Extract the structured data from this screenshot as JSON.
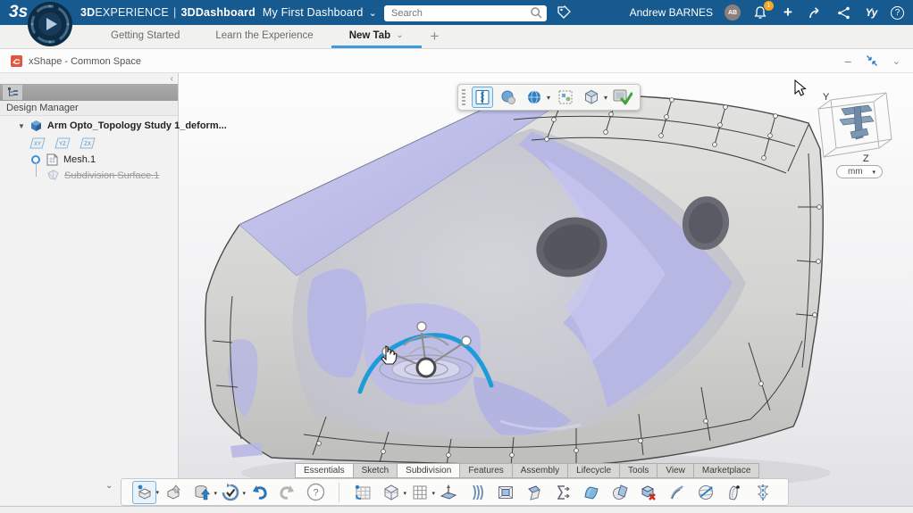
{
  "topbar": {
    "logo_text": "3s",
    "brand_bold": "3D",
    "brand_light": "EXPERIENCE",
    "separator": "|",
    "app_name": "3DDashboard",
    "dashboard_name": "My First Dashboard",
    "search_placeholder": "Search",
    "user_name": "Andrew BARNES",
    "user_initials": "AB",
    "notification_count": "1"
  },
  "glyphs": {
    "chevron_down": "⌄",
    "chevron_left": "‹",
    "minimize": "–",
    "plus": "+",
    "question": "?",
    "swym": "Yy",
    "caret": "▾",
    "tree_expand": "▼",
    "bar_chevron": "⌄"
  },
  "dashboard_tabs": {
    "items": [
      {
        "label": "Getting Started",
        "state": "default"
      },
      {
        "label": "Learn the Experience",
        "state": "default"
      },
      {
        "label": "New Tab",
        "state": "active"
      }
    ],
    "add_label": "+"
  },
  "app_header": {
    "title": "xShape - Common Space"
  },
  "left_panel": {
    "title": "Design Manager",
    "tree": {
      "root_label": "Arm Opto_Topology Study 1_deform...",
      "plane_icons": [
        "XY",
        "YZ",
        "ZX"
      ],
      "children": [
        {
          "label": "Mesh.1",
          "struck": false
        },
        {
          "label": "Subdivision Surface.1",
          "struck": true
        }
      ]
    }
  },
  "viewport": {
    "units_value": "mm",
    "axis_y": "Y",
    "axis_z": "Z",
    "view_toolbar_icons": [
      "section-zipper-tool",
      "shaded-sphere-style",
      "globe-render-mode",
      "custom-render-style",
      "cube-view-mode",
      "validate-ok"
    ]
  },
  "ribbon": {
    "active_tab": "Subdivision",
    "tabs": [
      {
        "label": "Essentials",
        "state": "light"
      },
      {
        "label": "Sketch",
        "state": "default"
      },
      {
        "label": "Subdivision",
        "state": "active"
      },
      {
        "label": "Features",
        "state": "default"
      },
      {
        "label": "Assembly",
        "state": "default"
      },
      {
        "label": "Lifecycle",
        "state": "default"
      },
      {
        "label": "Tools",
        "state": "default"
      },
      {
        "label": "View",
        "state": "default"
      },
      {
        "label": "Marketplace",
        "state": "default"
      }
    ]
  },
  "action_bar": {
    "standard_icons": [
      "new-content",
      "import-content",
      "save-data",
      "update",
      "undo",
      "redo",
      "help"
    ],
    "subdivision_icons": [
      "subdivision-surface",
      "primitive-shape",
      "mesh-grid",
      "extrude-face",
      "multi-section-surface",
      "frame-inset",
      "bevel-face",
      "align-edges",
      "fill-surface",
      "trim-by-plane",
      "delete-face",
      "styling-curve",
      "project-on-sphere",
      "offset-surface",
      "symmetry"
    ]
  },
  "colors": {
    "topbar_blue": "#175A8F",
    "accent_blue": "#2D9BD8",
    "badge_orange": "#F5A623",
    "lavender": "#BCBCE8",
    "model_gray": "#D6D6D4",
    "curve_blue": "#1E9CD7",
    "xshape_red": "#E2553F",
    "check_green": "#3FA535"
  }
}
